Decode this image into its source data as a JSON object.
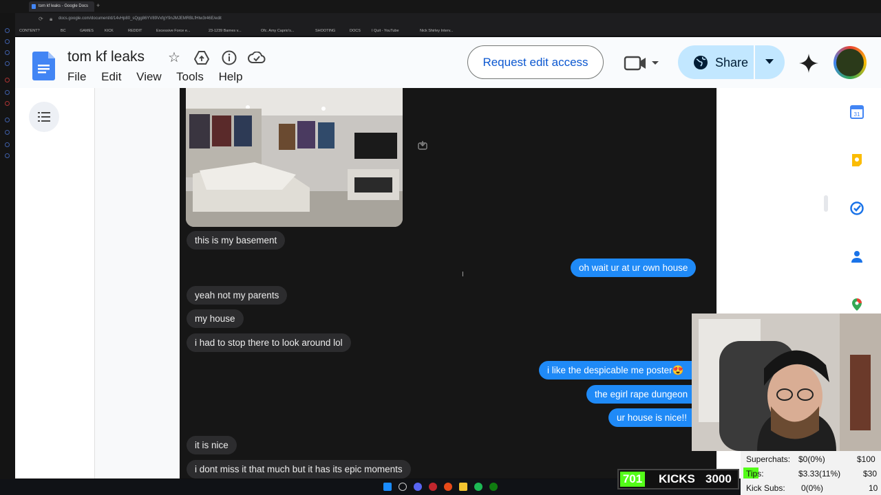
{
  "browser": {
    "tab_title": "tom kf leaks - Google Docs",
    "url": "docs.google.com/document/d/14vHp80_sQgg86YV89VxfgY9nJMJEMRBLfHtw3r46E/edit",
    "bookmarks": [
      "CONTENT?",
      "BC",
      "GAMES",
      "KICK",
      "REDDIT",
      "Excessive Force e...",
      "23-1239 Barnes v...",
      "Ofc. Amy Caprio's...",
      "SHOOTING",
      "DOCS",
      "I Quit - YouTube",
      "Nick Shirley Interv..."
    ]
  },
  "docs": {
    "title": "tom kf leaks",
    "menus": [
      "File",
      "Edit",
      "View",
      "Tools",
      "Help"
    ],
    "request_edit": "Request edit access",
    "share": "Share"
  },
  "chat": {
    "messages": [
      {
        "from": "them",
        "text": "this is my basement"
      },
      {
        "from": "me",
        "text": "oh wait ur at ur own house"
      },
      {
        "from": "them",
        "text": "yeah not my parents"
      },
      {
        "from": "them",
        "text": "my house"
      },
      {
        "from": "them",
        "text": "i had to stop there to look around lol"
      },
      {
        "from": "me",
        "text": "i like the despicable me poster😍"
      },
      {
        "from": "me",
        "text": "the egirl rape dungeon"
      },
      {
        "from": "me",
        "text": "ur house is nice!!"
      },
      {
        "from": "them",
        "text": "it is nice"
      },
      {
        "from": "them",
        "text": "i dont miss it that much but it has its epic moments"
      }
    ]
  },
  "sidebar_apps": [
    "calendar-icon",
    "keep-icon",
    "tasks-icon",
    "contacts-icon",
    "maps-icon"
  ],
  "calendar_day": "31",
  "stream": {
    "kicks_count": "701",
    "kicks_label": "KICKS",
    "kicks_goal": "3000",
    "stats": [
      {
        "label": "Superchats:",
        "value": "$0(0%)",
        "goal": "$100"
      },
      {
        "label": "Tips:",
        "value": "$3.33(11%)",
        "goal": "$30"
      },
      {
        "label": "Kick Subs:",
        "value": "0(0%)",
        "goal": "10"
      }
    ]
  },
  "colors": {
    "sent_bubble": "#1f8af7",
    "recv_bubble": "#2c2c2e",
    "docs_blue": "#0b57d0",
    "share_bg": "#c2e7ff",
    "kick_green": "#53fc18"
  }
}
